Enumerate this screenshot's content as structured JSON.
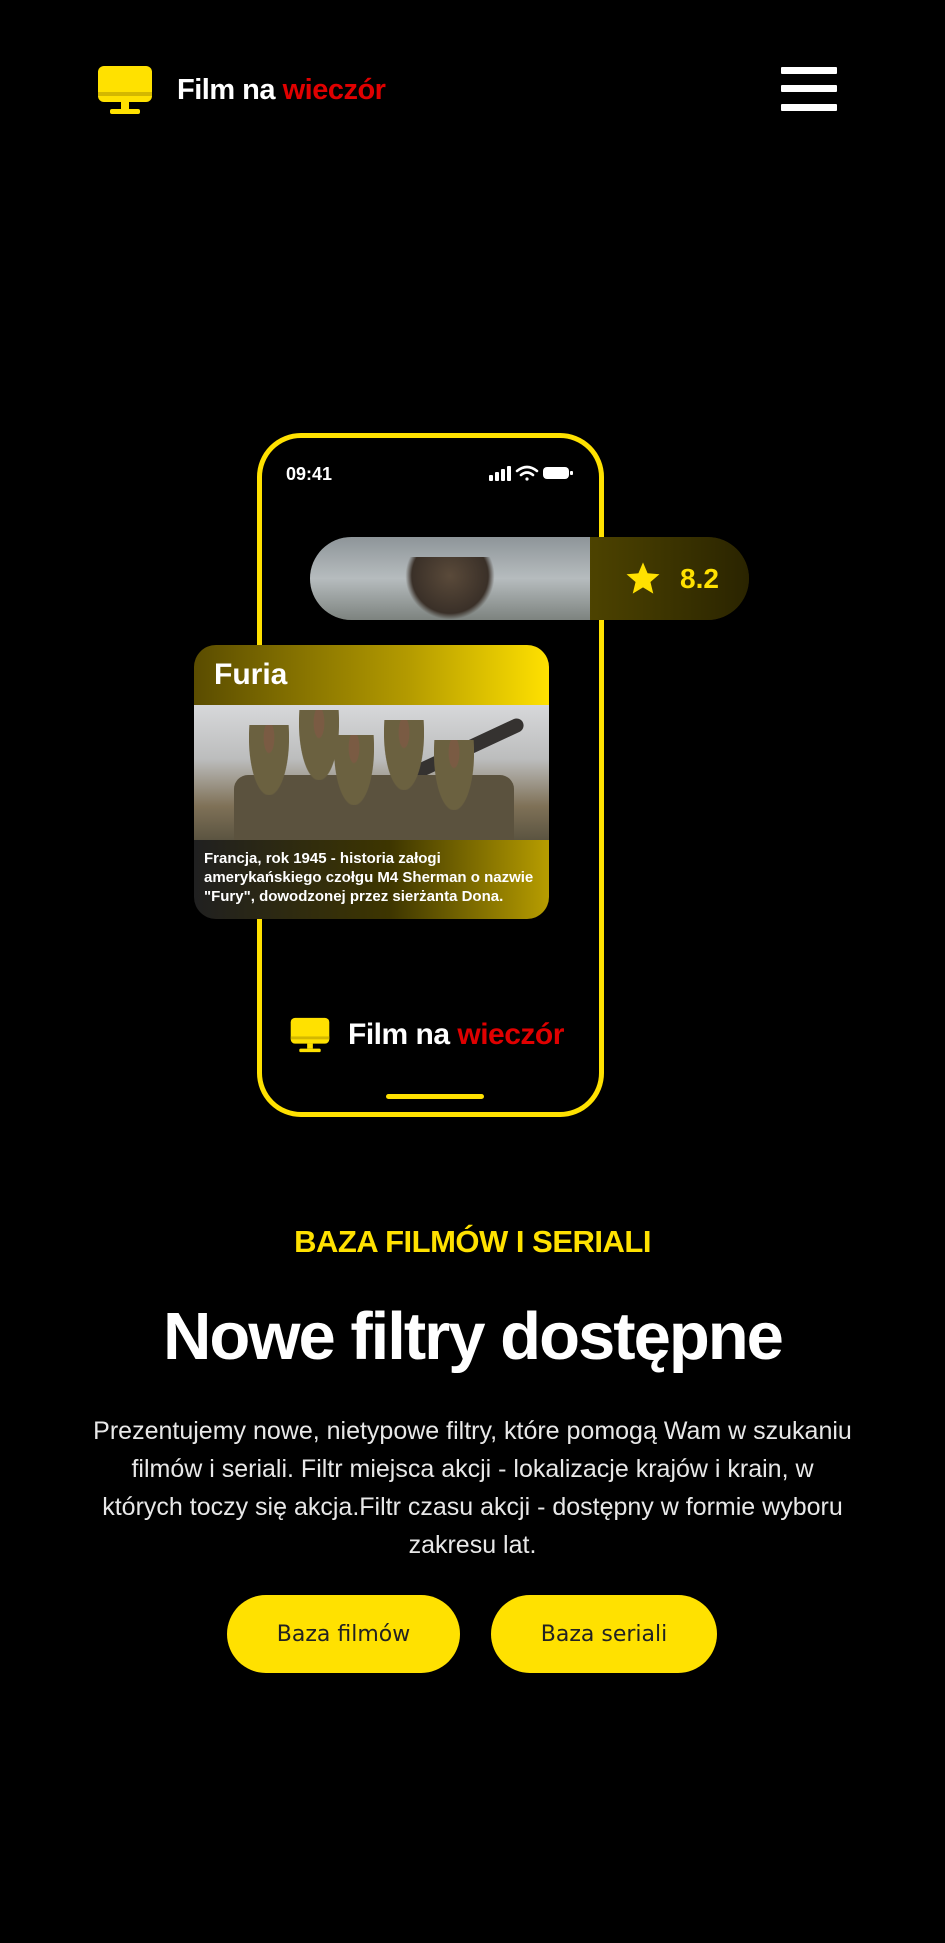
{
  "header": {
    "brand_main": "Film na",
    "brand_accent": "wieczór"
  },
  "phone": {
    "time": "09:41",
    "rating": {
      "value": "8.2"
    },
    "card": {
      "title": "Furia",
      "description": "Francja, rok 1945 - historia załogi amerykańskiego czołgu M4 Sherman o nazwie \"Fury\", dowodzonej przez sierżanta Dona."
    },
    "footer_brand_main": "Film na",
    "footer_brand_accent": "wieczór"
  },
  "hero": {
    "eyebrow": "BAZA FILMÓW I SERIALI",
    "headline": "Nowe filtry dostępne",
    "description": "Prezentujemy nowe, nietypowe filtry, które pomogą Wam w szukaniu filmów i seriali. Filtr miejsca akcji - lokalizacje krajów i krain, w których toczy się akcja.Filtr czasu akcji - dostępny w formie wyboru zakresu lat.",
    "button_films": "Baza filmów",
    "button_series": "Baza seriali"
  },
  "colors": {
    "accent": "#ffe100",
    "brand_red": "#e00000",
    "background": "#000000"
  },
  "icons": [
    "monitor-icon",
    "hamburger-menu-icon",
    "star-icon",
    "signal-icon",
    "wifi-icon",
    "battery-icon"
  ]
}
